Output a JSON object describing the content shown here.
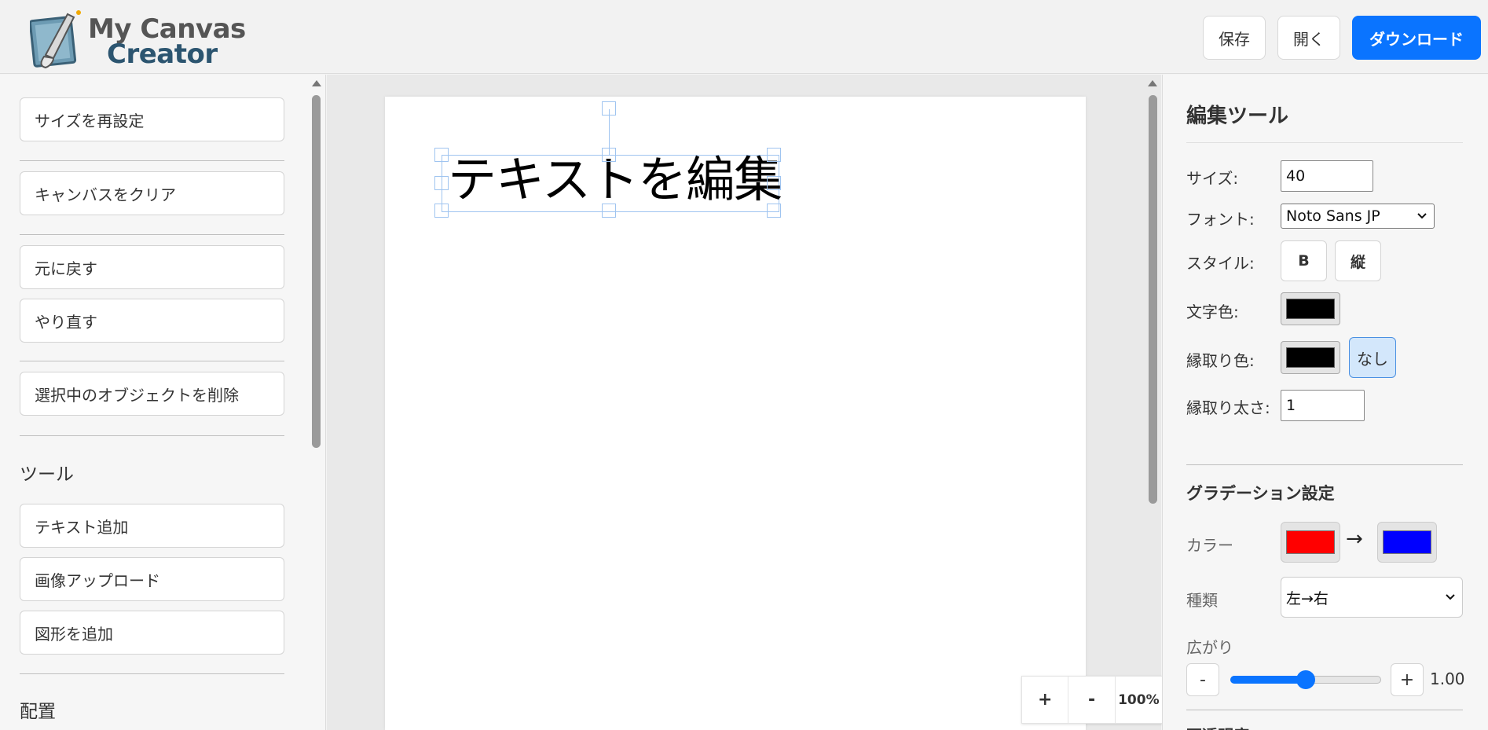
{
  "app": {
    "logo_line1": "My Canvas",
    "logo_line2": "Creator"
  },
  "header": {
    "save_label": "保存",
    "open_label": "開く",
    "download_label": "ダウンロード",
    "accent_color": "#0a74ff"
  },
  "left": {
    "buttons": [
      {
        "label": "サイズを再設定"
      },
      {
        "label": "キャンバスをクリア"
      },
      {
        "label": "元に戻す"
      },
      {
        "label": "やり直す"
      },
      {
        "label": "選択中のオブジェクトを削除"
      }
    ],
    "tools_heading": "ツール",
    "tools": [
      {
        "label": "テキスト追加"
      },
      {
        "label": "画像アップロード"
      },
      {
        "label": "図形を追加"
      }
    ],
    "layout_heading": "配置"
  },
  "canvas": {
    "text": "テキストを編集"
  },
  "zoom": {
    "plus_label": "+",
    "minus_label": "-",
    "level": "100%"
  },
  "right": {
    "title": "編集ツール",
    "size_label": "サイズ:",
    "size_value": "40",
    "font_label": "フォント:",
    "font_value": "Noto Sans JP",
    "style_label": "スタイル:",
    "bold_label": "B",
    "vertical_label": "縦",
    "text_color_label": "文字色:",
    "text_color": "#000000",
    "stroke_color_label": "縁取り色:",
    "stroke_color": "#000000",
    "none_label": "なし",
    "stroke_width_label": "縁取り太さ:",
    "stroke_width_value": "1",
    "gradient_title": "グラデーション設定",
    "color_label": "カラー",
    "gradient_from": "#ff0000",
    "gradient_to": "#0000ff",
    "arrow": "→",
    "type_label": "種類",
    "type_value": "左→右",
    "spread_label": "広がり",
    "spread_minus": "-",
    "spread_plus": "+",
    "spread_value": "1.00",
    "spread_fraction": 0.5,
    "next_section": "不透明度"
  }
}
